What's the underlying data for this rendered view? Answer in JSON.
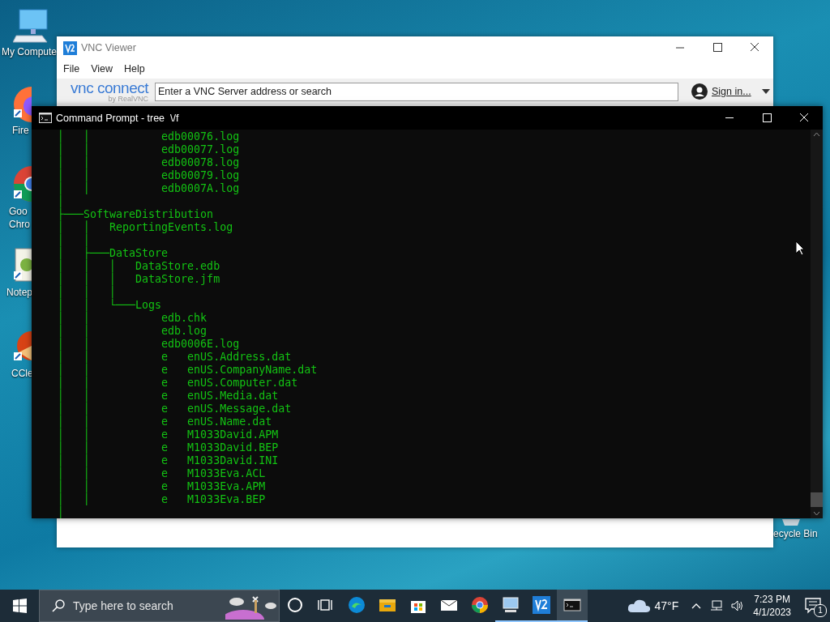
{
  "desktop_icons": [
    {
      "kind": "computer",
      "lines": [
        "My Compute"
      ]
    },
    {
      "kind": "firefox",
      "lines": [
        "Fire"
      ]
    },
    {
      "kind": "chrome",
      "lines": [
        "Goo",
        "Chro"
      ]
    },
    {
      "kind": "notepad",
      "lines": [
        "Notep"
      ]
    },
    {
      "kind": "ccleaner",
      "lines": [
        "CCle"
      ]
    },
    {
      "kind": "recycle",
      "lines": [
        "ecycle Bin"
      ]
    }
  ],
  "vnc_window": {
    "title": "VNC Viewer",
    "menu": [
      "File",
      "View",
      "Help"
    ],
    "logo": {
      "text": "vnc connect",
      "sub": "by RealVNC"
    },
    "search": {
      "placeholder": "Enter a VNC Server address or search"
    },
    "sign_in": "Sign in..."
  },
  "cmd_window": {
    "title": "Command Prompt - tree  \\/f",
    "lines": [
      "│   │           edb00076.log",
      "│   │           edb00077.log",
      "│   │           edb00078.log",
      "│   │           edb00079.log",
      "│   │           edb0007A.log",
      "│",
      "├───SoftwareDistribution",
      "│   │   ReportingEvents.log",
      "│   │",
      "│   ├───DataStore",
      "│   │   │   DataStore.edb",
      "│   │   │   DataStore.jfm",
      "│   │   │",
      "│   │   └───Logs",
      "│   │           edb.chk",
      "│   │           edb.log",
      "│   │           edb0006E.log",
      "│   │           e   enUS.Address.dat",
      "│   │           e   enUS.CompanyName.dat",
      "│   │           e   enUS.Computer.dat",
      "│   │           e   enUS.Media.dat",
      "│   │           e   enUS.Message.dat",
      "│   │           e   enUS.Name.dat",
      "│   │           e   M1033David.APM",
      "│   │           e   M1033David.BEP",
      "│   │           e   M1033David.INI",
      "│   │           e   M1033Eva.ACL",
      "│   │           e   M1033Eva.APM",
      "│   │           e   M1033Eva.BEP",
      "│"
    ]
  },
  "taskbar": {
    "search": {
      "placeholder": "Type here to search"
    },
    "apps": [
      {
        "kind": "cortana",
        "running": false,
        "selected": false
      },
      {
        "kind": "taskview",
        "running": false,
        "selected": false
      },
      {
        "kind": "edge",
        "running": false,
        "selected": false
      },
      {
        "kind": "explorer",
        "running": false,
        "selected": false
      },
      {
        "kind": "store",
        "running": false,
        "selected": false
      },
      {
        "kind": "mail",
        "running": false,
        "selected": false
      },
      {
        "kind": "chrome",
        "running": false,
        "selected": false
      },
      {
        "kind": "computer",
        "running": true,
        "selected": false
      },
      {
        "kind": "vnc",
        "running": true,
        "selected": false
      },
      {
        "kind": "cmd",
        "running": true,
        "selected": true
      }
    ],
    "weather": "47°F",
    "time": "7:23 PM",
    "date": "4/1/2023",
    "notifications": "1"
  }
}
